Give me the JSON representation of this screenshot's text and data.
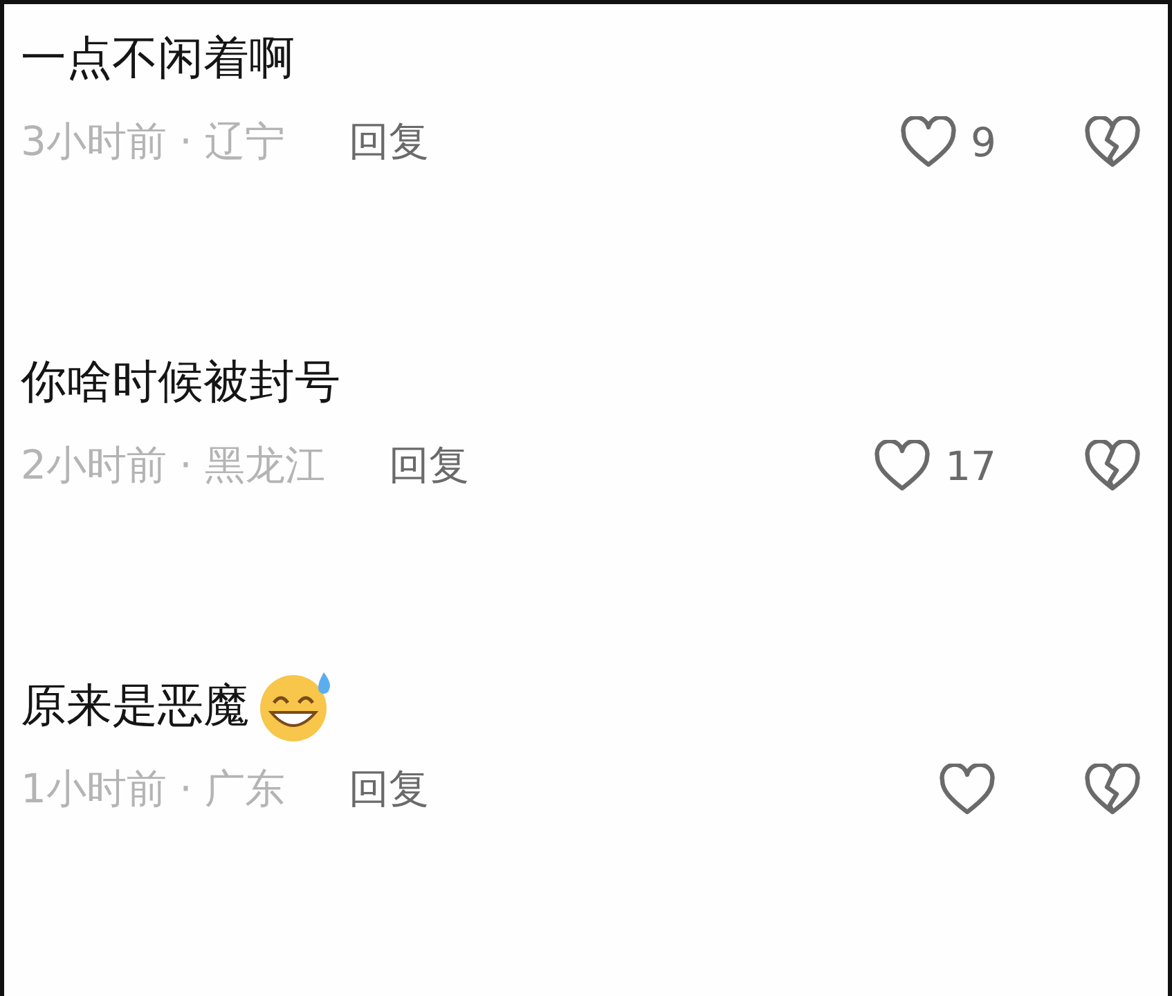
{
  "comments": [
    {
      "text": "一点不闲着啊",
      "meta": "3小时前 · 辽宁",
      "reply": "回复",
      "likes": "9"
    },
    {
      "text": "你啥时候被封号",
      "meta": "2小时前 · 黑龙江",
      "reply": "回复",
      "likes": "17"
    },
    {
      "text": "原来是恶魔",
      "emoji": true,
      "meta": "1小时前 · 广东",
      "reply": "回复"
    }
  ]
}
